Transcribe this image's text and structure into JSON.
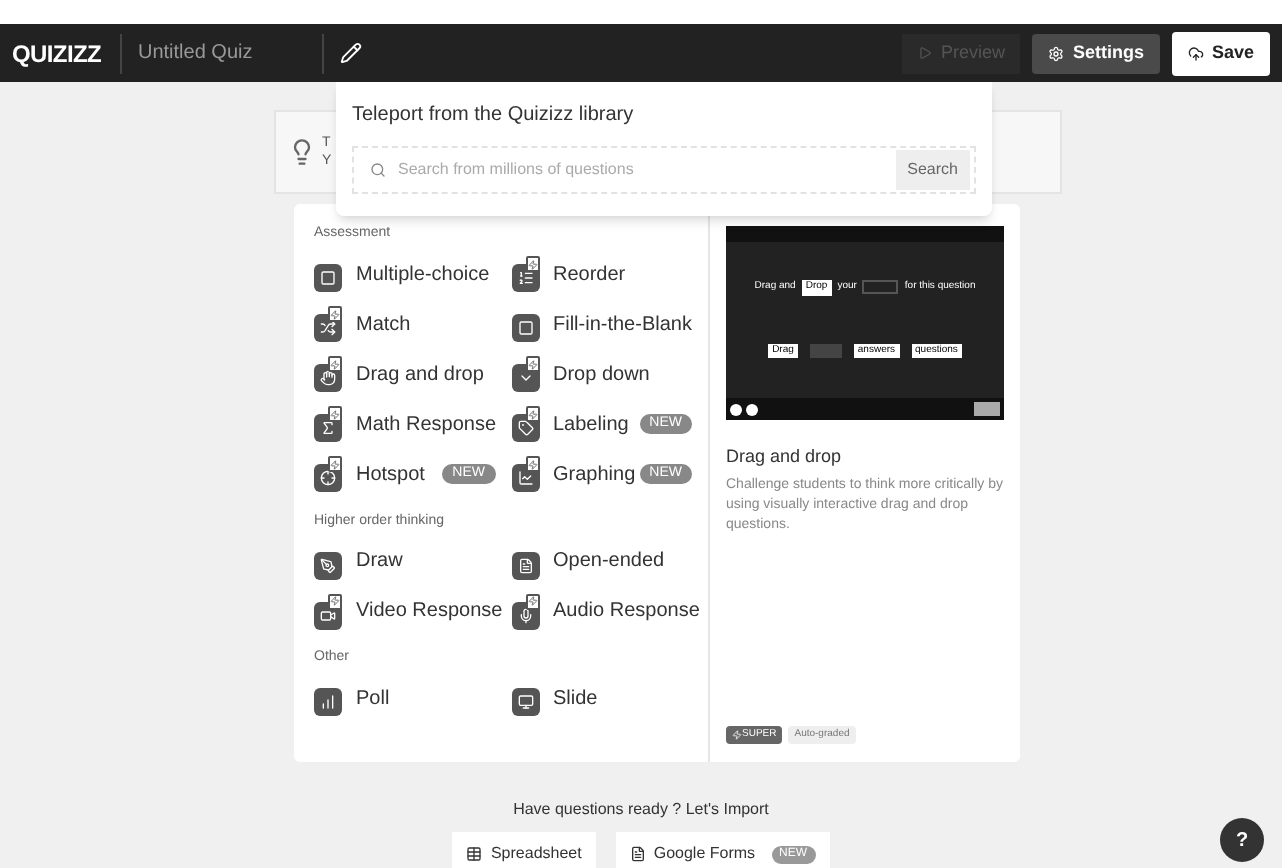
{
  "topbar": {
    "logo": "QUIZIZZ",
    "quiz_title": "Untitled Quiz",
    "preview": "Preview",
    "settings": "Settings",
    "save": "Save"
  },
  "tip": {
    "line_1": "T",
    "line_2": "Y"
  },
  "library": {
    "title": "Teleport from the Quizizz library",
    "placeholder": "Search from millions of questions",
    "button": "Search"
  },
  "sections": [
    {
      "title": "Assessment",
      "items": [
        {
          "label": "Multiple-choice",
          "super": false
        },
        {
          "label": "Reorder",
          "super": true
        },
        {
          "label": "Match",
          "super": true
        },
        {
          "label": "Fill-in-the-Blank",
          "super": false
        },
        {
          "label": "Drag and drop",
          "super": true
        },
        {
          "label": "Drop down",
          "super": true
        },
        {
          "label": "Math Response",
          "super": true
        },
        {
          "label": "Labeling",
          "super": true,
          "badge": "NEW"
        },
        {
          "label": "Hotspot",
          "super": true,
          "badge": "NEW"
        },
        {
          "label": "Graphing",
          "super": true,
          "badge": "NEW"
        }
      ]
    },
    {
      "title": "Higher order thinking",
      "items": [
        {
          "label": "Draw",
          "super": false
        },
        {
          "label": "Open-ended",
          "super": false
        },
        {
          "label": "Video Response",
          "super": true
        },
        {
          "label": "Audio Response",
          "super": true
        }
      ]
    },
    {
      "title": "Other",
      "items": [
        {
          "label": "Poll",
          "super": false
        },
        {
          "label": "Slide",
          "super": false
        }
      ]
    }
  ],
  "detail": {
    "sample": {
      "sentence_start": "Drag and",
      "filled": "Drop",
      "sentence_mid": "your",
      "sentence_end": "for this question",
      "options": [
        "Drag",
        "answers",
        "questions"
      ]
    },
    "title": "Drag and drop",
    "description": "Challenge students to think more critically by using visually interactive drag and drop questions.",
    "tags": [
      "SUPER",
      "Auto-graded"
    ]
  },
  "import": {
    "heading": "Have questions ready ? Let's Import",
    "buttons": [
      {
        "label": "Spreadsheet"
      },
      {
        "label": "Google Forms",
        "badge": "NEW"
      }
    ]
  },
  "help": "?"
}
